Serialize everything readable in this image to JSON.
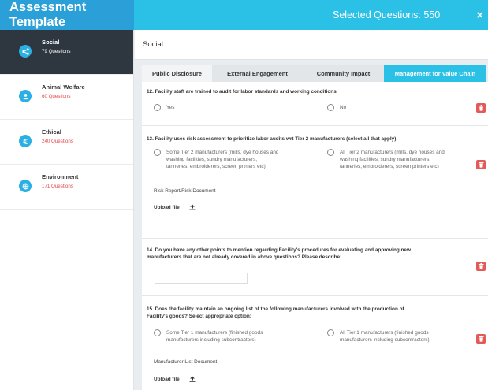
{
  "header": {
    "title": "Assessment Template",
    "selected": "Selected Questions: 550",
    "close": "×"
  },
  "sidebar": {
    "items": [
      {
        "label": "Social",
        "count": "79 Questions",
        "icon": "share-icon"
      },
      {
        "label": "Animal Welfare",
        "count": "60 Questions",
        "icon": "user-icon"
      },
      {
        "label": "Ethical",
        "count": "240 Questions",
        "icon": "currency-icon"
      },
      {
        "label": "Environment",
        "count": "171 Questions",
        "icon": "globe-icon"
      }
    ]
  },
  "main": {
    "section_title": "Social",
    "tabs": [
      {
        "label": "Public Disclosure"
      },
      {
        "label": "External Engagement"
      },
      {
        "label": "Community Impact"
      },
      {
        "label": "Management for Value Chain"
      }
    ]
  },
  "questions": {
    "q12": {
      "text": "12. Facility staff are trained to audit for labor standards and working conditions",
      "opt_a": "Yes",
      "opt_b": "No"
    },
    "q13": {
      "text": "13. Facility uses risk assessment to prioritize labor audits wrt Tier 2 manufacturers (select all that apply):",
      "opt_a_l1": "Some Tier 2 manufacturers (mills, dye houses and",
      "opt_a_l2": "washing facilities, sundry manufacturers,",
      "opt_a_l3": "tanneries, embroiderers, screen printers etc)",
      "opt_b_l1": "All Tier 2 manufacturers (mills, dye houses and",
      "opt_b_l2": "washing facilities, sundry manufacturers,",
      "opt_b_l3": "tanneries, embroiderers, screen printers etc)",
      "doc_label": "Risk Report/Risk Document",
      "upload_label": "Upload file"
    },
    "q14": {
      "text_l1": "14. Do you have any other points to mention regarding Facility's procedures for evaluating and approving new",
      "text_l2": "manufacturers that are not already covered in above questions? Please describe:",
      "input_value": ""
    },
    "q15": {
      "text_l1": "15. Does the facility maintain an ongoing list of the following manufacturers involved with the production of",
      "text_l2": "Facility's goods? Select appropriate option:",
      "opt_a_l1": "Some Tier 1 manufacturers (finished goods",
      "opt_a_l2": "manufacturers including subcontractors)",
      "opt_b_l1": "All Tier 1 manufacturers (finished goods",
      "opt_b_l2": "manufacturers including subcontractors)",
      "doc_label": "Manufacturer List Document",
      "upload_label": "Upload file"
    }
  },
  "colors": {
    "header_left": "#2a9fd8",
    "header_right": "#2bc0e6",
    "sidebar_active": "#2e3640",
    "active_tab": "#2bc0e6",
    "count_text": "#e54545",
    "delete_button": "#e35a5a"
  }
}
